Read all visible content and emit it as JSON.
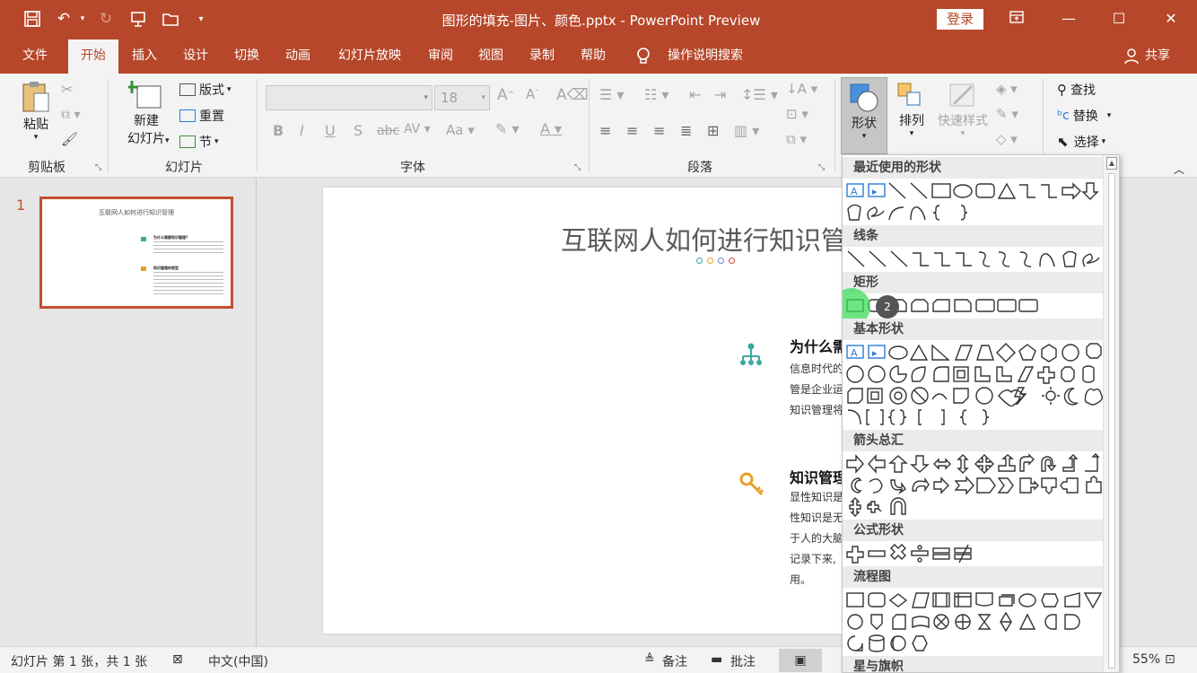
{
  "window": {
    "title": "图形的填充-图片、颜色.pptx  -  PowerPoint Preview",
    "login_label": "登录",
    "quick_access_icons": [
      "save-icon",
      "undo-icon",
      "redo-icon",
      "present-icon",
      "open-icon",
      "customize-icon"
    ]
  },
  "tabs": [
    {
      "label": "文件"
    },
    {
      "label": "开始"
    },
    {
      "label": "插入"
    },
    {
      "label": "设计"
    },
    {
      "label": "切换"
    },
    {
      "label": "动画"
    },
    {
      "label": "幻灯片放映"
    },
    {
      "label": "审阅"
    },
    {
      "label": "视图"
    },
    {
      "label": "录制"
    },
    {
      "label": "帮助"
    }
  ],
  "tell_me": "操作说明搜索",
  "share_label": "共享",
  "ribbon": {
    "clipboard": {
      "paste": "粘贴",
      "group": "剪贴板"
    },
    "slides": {
      "new_slide_1": "新建",
      "new_slide_2": "幻灯片",
      "layout": "版式",
      "reset": "重置",
      "section": "节",
      "group": "幻灯片"
    },
    "font": {
      "size": "18",
      "group": "字体",
      "bold": "B",
      "italic": "I",
      "underline": "U",
      "shadow": "S",
      "strike": "abc"
    },
    "paragraph": {
      "group": "段落"
    },
    "drawing": {
      "shapes": "形状",
      "arrange": "排列",
      "quick_styles": "快速样式"
    },
    "editing": {
      "find": "查找",
      "replace": "替换",
      "select": "选择"
    }
  },
  "thumbnail": {
    "number": "1",
    "title": "互联网人如何进行知识管理",
    "h1": "为什么需要知识管理?",
    "h2": "知识管理的类型"
  },
  "slide": {
    "title": "互联网人如何进行知识管",
    "section1": {
      "heading": "为什么需",
      "lines": [
        "信息时代的",
        "管是企业运",
        "知识管理将"
      ]
    },
    "section2": {
      "heading": "知识管理",
      "lines": [
        "显性知识是",
        "性知识是无",
        "于人的大脑",
        "记录下来,",
        "用。"
      ]
    }
  },
  "colors": {
    "accent": "#b7472a",
    "teal": "#3aa9a0",
    "gold": "#e8a12a",
    "highlight": "#3cdc5a"
  },
  "shapes_panel": {
    "categories": [
      "最近使用的形状",
      "线条",
      "矩形",
      "基本形状",
      "箭头总汇",
      "公式形状",
      "流程图",
      "星与旗帜"
    ],
    "cursor_badge": "2"
  },
  "status": {
    "slide_info": "幻灯片 第 1 张，共 1 张",
    "language": "中文(中国)",
    "notes": "备注",
    "comments": "批注",
    "zoom": "55%"
  }
}
